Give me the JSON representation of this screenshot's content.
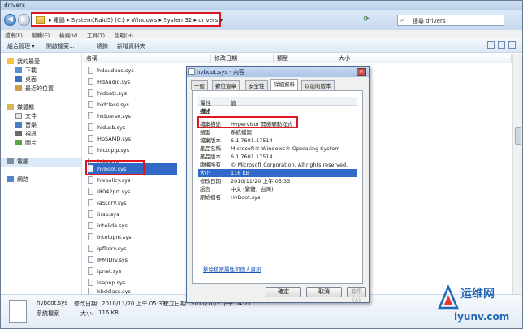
{
  "window": {
    "title": "drivers"
  },
  "address": {
    "crumbs": "▸ 電腦 ▸ System(Raid5) (C:) ▸ Windows ▸ System32 ▸ drivers ▾",
    "search_placeholder": "搜尋 drivers"
  },
  "menu": [
    "檔案(F)",
    "編輯(E)",
    "檢視(V)",
    "工具(T)",
    "說明(H)"
  ],
  "toolbar": {
    "organize": "組合管理 ▾",
    "open_with": "開啟檔案...",
    "burn": "燒錄",
    "new_folder": "新增資料夾"
  },
  "sidebar": {
    "favorites": "我的最愛",
    "fav_items": [
      "下載",
      "桌面",
      "最近的位置"
    ],
    "libraries": "媒體櫃",
    "lib_items": [
      "文件",
      "音樂",
      "視訊",
      "圖片"
    ],
    "computer": "電腦",
    "network": "網路"
  },
  "columns": {
    "name": "名稱",
    "modified": "修改日期",
    "type": "類型",
    "size": "大小"
  },
  "files": [
    "hdaudbus.sys",
    "HdAudio.sys",
    "hidbatt.sys",
    "hidclass.sys",
    "hidparse.sys",
    "hidusb.sys",
    "HpSAMD.sys",
    "htctcpip.sys",
    "http.sys",
    "hvboot.sys",
    "hwpolicy.sys",
    "i8042prt.sys",
    "iaStorV.sys",
    "iirsp.sys",
    "intelide.sys",
    "intelppm.sys",
    "ipfltdrv.sys",
    "IPMIDrv.sys",
    "ipnat.sys",
    "isapnp.sys",
    "kbdclass.sys"
  ],
  "selected_file": "hvboot.sys",
  "dialog": {
    "title": "hvboot.sys - 內容",
    "close": "✕",
    "tabs": [
      "一般",
      "數位簽章",
      "安全性",
      "詳細資料",
      "以前的版本"
    ],
    "active_tab": "詳細資料",
    "hdr_prop": "屬性",
    "hdr_value": "值",
    "section": "描述",
    "rows": [
      {
        "k": "檔案描述",
        "v": "Hypervisor 開機驅動程式"
      },
      {
        "k": "類型",
        "v": "系統檔案"
      },
      {
        "k": "檔案版本",
        "v": "6.1.7601.17514"
      },
      {
        "k": "產品名稱",
        "v": "Microsoft® Windows® Operating System"
      },
      {
        "k": "產品版本",
        "v": "6.1.7601.17514"
      },
      {
        "k": "版權所有",
        "v": "© Microsoft Corporation. All rights reserved."
      },
      {
        "k": "大小",
        "v": "116 KB"
      },
      {
        "k": "修改日期",
        "v": "2010/11/20 上午 05:33"
      },
      {
        "k": "語言",
        "v": "中文 (繁體，台灣)"
      },
      {
        "k": "原始檔名",
        "v": "HvBoot.sys"
      }
    ],
    "link": "移除檔案屬性和個人資訊",
    "ok": "確定",
    "cancel": "取消",
    "apply": "套用(A)"
  },
  "details_pane": {
    "name": "hvboot.sys",
    "modified_label": "修改日期:",
    "modified": "2010/11/20 上午 05:33",
    "created_label": "建立日期:",
    "created": "2011/10/2 下午 04:21",
    "type": "系統檔案",
    "size_label": "大小:",
    "size": "116 KB"
  },
  "watermark": {
    "cn": "运维网",
    "en": "iyunv.com"
  }
}
